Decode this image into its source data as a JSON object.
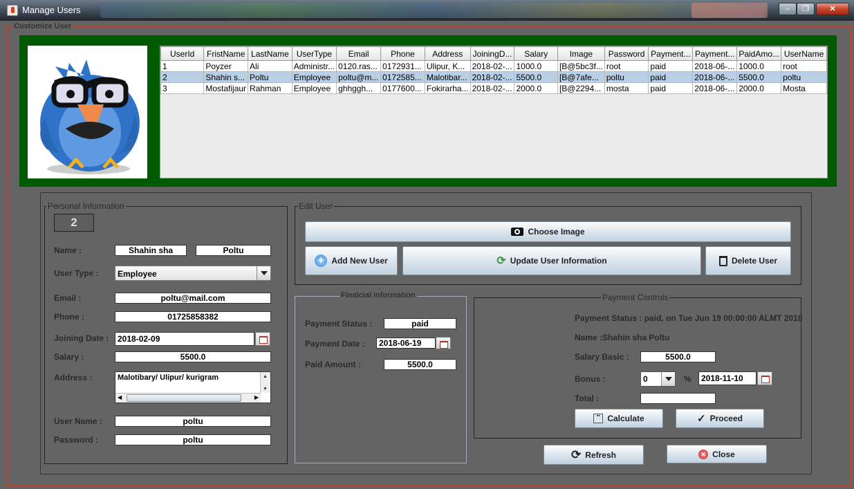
{
  "window": {
    "title": "Manage Users",
    "min": "–",
    "max": "❐",
    "close": "✕"
  },
  "customize_title": "Customize User",
  "table": {
    "columns": [
      "UserId",
      "FristName",
      "LastName",
      "UserType",
      "Email",
      "Phone",
      "Address",
      "JoiningD...",
      "Salary",
      "Image",
      "Password",
      "Payment...",
      "Payment...",
      "PaidAmo...",
      "UserName"
    ],
    "rows": [
      [
        "1",
        "Poyzer",
        "Ali",
        "Administr...",
        "0120.ras...",
        "0172931...",
        "Ulipur, K...",
        "2018-02-...",
        "1000.0",
        "[B@5bc3f...",
        "root",
        "paid",
        "2018-06-...",
        "1000.0",
        "root"
      ],
      [
        "2",
        "Shahin s...",
        "Poltu",
        "Employee",
        "poltu@m...",
        "0172585...",
        "Malotibar...",
        "2018-02-...",
        "5500.0",
        "[B@7afe...",
        "poltu",
        "paid",
        "2018-06-...",
        "5500.0",
        "poltu"
      ],
      [
        "3",
        "Mostafijaur",
        "Rahman",
        "Employee",
        "ghhggh...",
        "0177600...",
        "Fokirarha...",
        "2018-02-...",
        "2000.0",
        "[B@2294...",
        "mosta",
        "paid",
        "2018-06-...",
        "2000.0",
        "Mosta"
      ]
    ]
  },
  "personal": {
    "title": "Personal Information",
    "id": "2",
    "name_label": "Name :",
    "first_name": "Shahin sha",
    "last_name": "Poltu",
    "user_type_label": "User Type :",
    "user_type": "Employee",
    "email_label": "Email :",
    "email": "poltu@mail.com",
    "phone_label": "Phone :",
    "phone": "01725858382",
    "joining_label": "Joining Date :",
    "joining": "2018-02-09",
    "salary_label": "Salary :",
    "salary": "5500.0",
    "address_label": "Address :",
    "address": "Malotibary/ Ulipur/ kurigram",
    "username_label": "User Name :",
    "username": "poltu",
    "password_label": "Password :",
    "password": "poltu"
  },
  "edit": {
    "title": "Edit User",
    "choose_image": "Choose Image",
    "add_user": "Add New User",
    "update_user": "Update User Information",
    "delete_user": "Delete User"
  },
  "financial": {
    "title": "Finalcial information",
    "status_label": "Payment Status :",
    "status": "paid",
    "date_label": "Payment Date :",
    "date": "2018-06-19",
    "amount_label": "Paid Amount :",
    "amount": "5500.0"
  },
  "payment": {
    "title": "Payment Controls",
    "status_text": "Payment Status : paid, on Tue Jun 19 00:00:00 ALMT 2018",
    "name_text": "Name :Shahin sha  Poltu",
    "salary_label": "Salary Basic :",
    "salary": "5500.0",
    "bonus_label": "Bonus :",
    "bonus": "0",
    "percent": "%",
    "date": "2018-11-10",
    "total_label": "Total :",
    "total": "",
    "calculate": "Calculate",
    "proceed": "Proceed"
  },
  "refresh": "Refresh",
  "close": "Close",
  "colors": {
    "background": "#646464",
    "green_panel": "#005a00",
    "border_accent": "#c4442e",
    "selected_row": "#b8cfe5"
  }
}
